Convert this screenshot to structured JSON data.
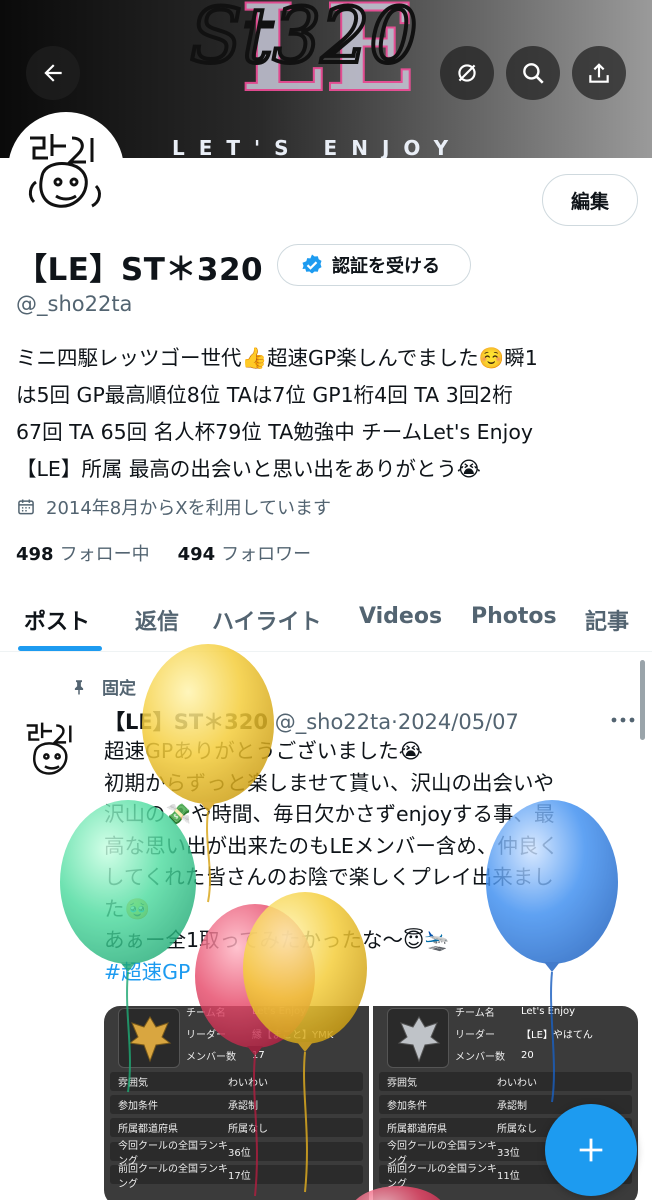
{
  "colors": {
    "accent": "#1d9bf0",
    "text_primary": "#0f1419",
    "text_secondary": "#536471",
    "balloon_yellow": "#f4cd3b",
    "balloon_green": "#4fdca0",
    "balloon_red": "#e64a6a",
    "balloon_blue": "#3d8ef0"
  },
  "banner": {
    "logo_text": "St320",
    "logo_letters": "LE",
    "tagline": "LET'S ENJOY"
  },
  "header_buttons": {
    "back_icon": "arrow-left-icon",
    "mute_icon": "eye-slash-icon",
    "search_icon": "search-icon",
    "share_icon": "share-icon"
  },
  "profile": {
    "display_name": "【LE】ST＊320",
    "verify_label": "認証を受ける",
    "handle": "@_sho22ta",
    "edit_label": "編集",
    "bio_lines": [
      "ミニ四駆レッツゴー世代👍超速GP楽しんでました☺️瞬1",
      "は5回 GP最高順位8位 TAは7位 GP1桁4回 TA 3回2桁",
      "67回 TA 65回 名人杯79位 TA勉強中 チームLet's Enjoy",
      "【LE】所属 最高の出会いと思い出をありがとう😭"
    ],
    "joined": "2014年8月からXを利用しています",
    "following_count": "498",
    "following_label": "フォロー中",
    "followers_count": "494",
    "followers_label": "フォロワー"
  },
  "tabs": [
    "ポスト",
    "返信",
    "ハイライト",
    "Videos",
    "Photos",
    "記事"
  ],
  "pinned_tweet": {
    "pinned_label": "固定",
    "author_name": "【LE】ST＊320",
    "author_handle": "@_sho22ta",
    "separator": "·",
    "date": "2024/05/07",
    "lines": [
      "超速GPありがとうございました😭",
      "初期からずっと楽しませて貰い、沢山の出会いや",
      "沢山の💸や時間、毎日欠かさずenjoyする事、最",
      "高な思い出が出来たのもLEメンバー含め、仲良く",
      "してくれた皆さんのお陰で楽しくプレイ出来まし",
      "た🥹",
      "あぁー全1取ってみたかったな〜😇🛬"
    ],
    "hashtag": "#超速GP"
  },
  "media": {
    "left": {
      "rows": [
        {
          "k": "チーム名",
          "v": "Let's Enjoy"
        },
        {
          "k": "リーダー",
          "v": "縁【まこと】YMK"
        },
        {
          "k": "メンバー数",
          "v": "17"
        }
      ],
      "bars": [
        {
          "k": "雰囲気",
          "v": "わいわい"
        },
        {
          "k": "参加条件",
          "v": "承認制"
        },
        {
          "k": "所属都道府県",
          "v": "所属なし"
        },
        {
          "k": "今回クールの全国ランキング",
          "v": "36位"
        },
        {
          "k": "前回クールの全国ランキング",
          "v": "17位"
        }
      ]
    },
    "right": {
      "rows": [
        {
          "k": "チーム名",
          "v": "Let's Enjoy"
        },
        {
          "k": "リーダー",
          "v": "【LE】やはてん"
        },
        {
          "k": "メンバー数",
          "v": "20"
        }
      ],
      "bars": [
        {
          "k": "雰囲気",
          "v": "わいわい"
        },
        {
          "k": "参加条件",
          "v": "承認制"
        },
        {
          "k": "所属都道府県",
          "v": "所属なし"
        },
        {
          "k": "今回クールの全国ランキング",
          "v": "33位"
        },
        {
          "k": "前回クールの全国ランキング",
          "v": "11位"
        }
      ]
    }
  },
  "fab_icon": "plus-icon"
}
